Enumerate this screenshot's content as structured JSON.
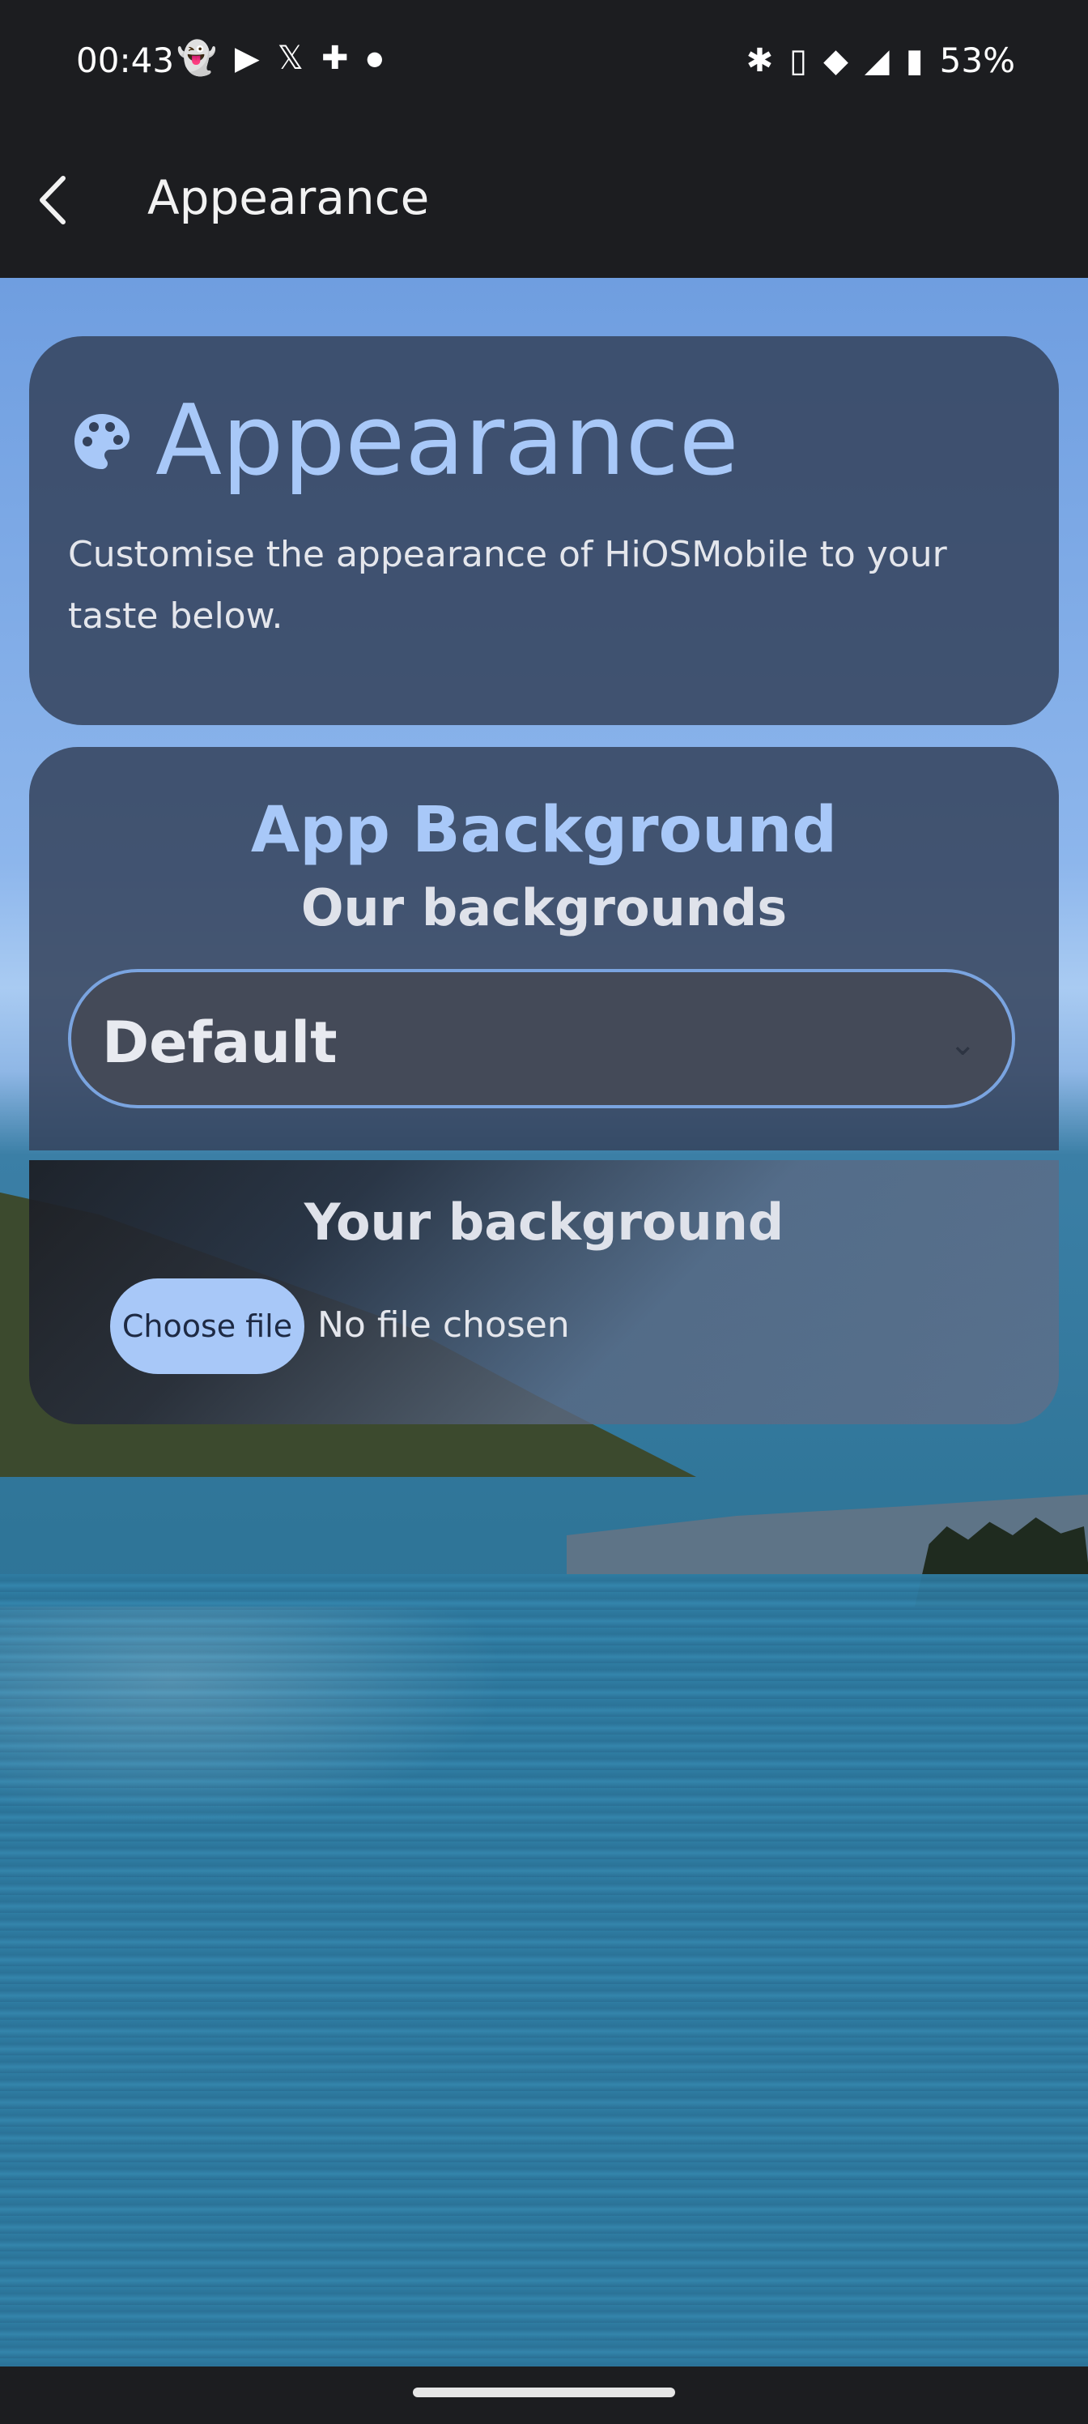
{
  "status_bar": {
    "time": "00:43",
    "left_icons": [
      "snapchat-icon",
      "youtube-icon",
      "x-icon",
      "slack-icon",
      "dot-icon"
    ],
    "right_icons": [
      "bluetooth-icon",
      "vibrate-icon",
      "wifi-icon",
      "signal-icon",
      "battery-icon"
    ],
    "battery": "53%"
  },
  "app_bar": {
    "title": "Appearance",
    "back_icon": "chevron-left-icon"
  },
  "header_card": {
    "icon": "palette-icon",
    "title": "Appearance",
    "description": "Customise the appearance of HiOSMobile to your taste below."
  },
  "background_card": {
    "title": "App Background",
    "subtitle": "Our backgrounds",
    "select": {
      "value": "Default"
    }
  },
  "custom_card": {
    "title": "Your background",
    "file_button": "Choose file",
    "file_status": "No file chosen"
  },
  "colors": {
    "accent": "#a8c8f8",
    "card_bg": "#34425c",
    "bar_bg": "#1c1d20"
  }
}
